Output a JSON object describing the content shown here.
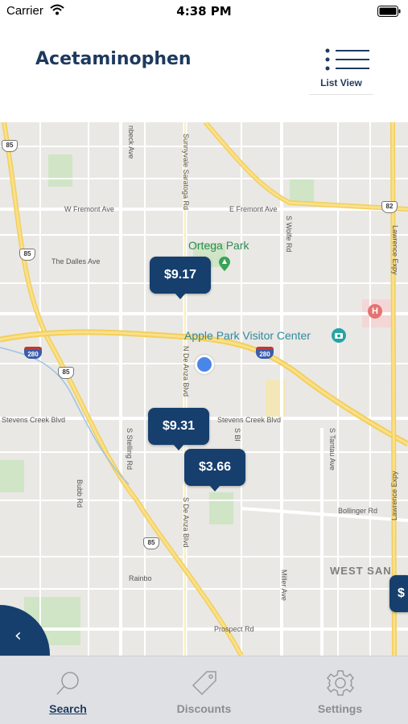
{
  "status_bar": {
    "carrier": "Carrier",
    "time": "4:38 PM"
  },
  "header": {
    "title": "Acetaminophen",
    "list_view_label": "List View"
  },
  "map": {
    "poi": {
      "park": "Ortega Park",
      "visitor_center": "Apple Park Visitor Center"
    },
    "area": "WEST SAN",
    "streets": {
      "w_fremont": "W Fremont Ave",
      "e_fremont": "E Fremont Ave",
      "dalles": "The Dalles Ave",
      "stevens_w": "Stevens Creek Blvd",
      "stevens_e": "Stevens Creek Blvd",
      "bollinger": "Bollinger Rd",
      "prospect": "Prospect Rd",
      "rainbow": "Rainbo",
      "sunnyvale": "Sunnyvale Saratoga Rd",
      "wolfe": "S Wolfe Rd",
      "deanza_n": "N De Anza Blvd",
      "deanza_s": "S De Anza Blvd",
      "stelling": "S Stelling Rd",
      "bubb": "Bubb Rd",
      "tantau": "S Tantau Ave",
      "miller": "Miller Ave",
      "lawrence_n": "Lawrence Expy",
      "lawrence_s": "Lawrence Expy",
      "knickerbocker": "nbeck Ave",
      "s_bl": "S Bl"
    },
    "shields": {
      "s85a": "85",
      "s85b": "85",
      "s85c": "85",
      "s85d": "85",
      "s82": "82",
      "i280a": "280",
      "i280b": "280"
    },
    "pins": [
      {
        "price": "$9.17"
      },
      {
        "price": "$9.31"
      },
      {
        "price": "$3.66"
      },
      {
        "price": "$"
      }
    ]
  },
  "tabs": [
    {
      "label": "Search"
    },
    {
      "label": "Discounts"
    },
    {
      "label": "Settings"
    }
  ],
  "colors": {
    "brand": "#163f6e",
    "title": "#1d3a5e",
    "tab_bar": "#dfe0e4",
    "location": "#4a86e8"
  },
  "icons": {
    "wifi": "wifi-icon",
    "battery": "battery-icon",
    "list": "list-icon",
    "back": "chevron-left-icon",
    "search": "search-icon",
    "discounts": "tag-icon",
    "settings": "gear-icon"
  }
}
